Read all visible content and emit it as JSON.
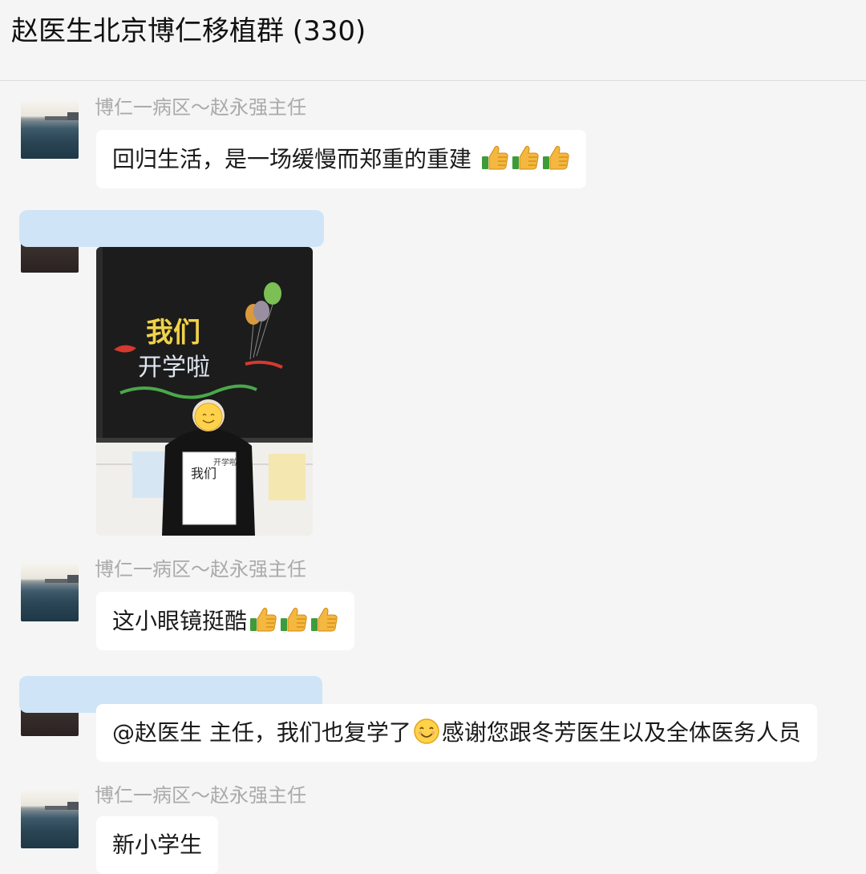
{
  "header": {
    "title": "赵医生北京博仁移植群 (330)"
  },
  "messages": [
    {
      "sender": "博仁一病区～赵永强主任",
      "text": "回归生活，是一场缓慢而郑重的重建",
      "emoji_count": 3,
      "emoji": "thumbs-up-icon"
    },
    {
      "sender": "",
      "type": "image",
      "image_text": {
        "board_line1": "我们",
        "board_line2": "开学啦",
        "sign_left": "我们",
        "sign_right": "开学啦"
      }
    },
    {
      "sender": "博仁一病区～赵永强主任",
      "text": "这小眼镜挺酷",
      "emoji_count": 3,
      "emoji": "thumbs-up-icon"
    },
    {
      "sender": "",
      "text_part1": "@赵医生 主任，我们也复学了",
      "text_part2": "感谢您跟冬芳医生以及全体医务人员",
      "emoji": "smile-icon"
    },
    {
      "sender": "博仁一病区～赵永强主任",
      "text": "新小学生"
    }
  ],
  "colors": {
    "background": "#f5f5f5",
    "bubble": "#ffffff",
    "sender_text": "#aaaaaa",
    "privacy_blur": "#cfe4f7"
  }
}
